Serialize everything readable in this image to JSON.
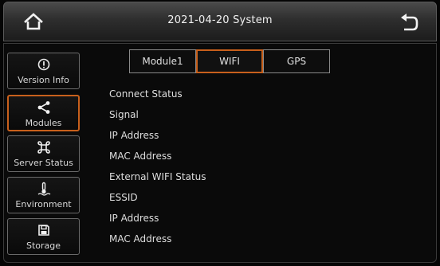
{
  "header": {
    "title": "2021-04-20  System",
    "home_icon": "home-icon",
    "back_icon": "back-arrow-icon"
  },
  "sidebar": {
    "items": [
      {
        "label": "Version Info",
        "icon": "info-circle-icon",
        "active": false
      },
      {
        "label": "Modules",
        "icon": "share-icon",
        "active": true
      },
      {
        "label": "Server Status",
        "icon": "command-icon",
        "active": false
      },
      {
        "label": "Environment",
        "icon": "thermometer-icon",
        "active": false
      },
      {
        "label": "Storage",
        "icon": "floppy-disk-icon",
        "active": false
      }
    ]
  },
  "tabs": [
    {
      "label": "Module1",
      "active": false
    },
    {
      "label": "WIFI",
      "active": true
    },
    {
      "label": "GPS",
      "active": false
    }
  ],
  "wifi": {
    "rows": [
      "Connect Status",
      "Signal",
      "IP Address",
      "MAC Address",
      "External WIFI Status",
      "ESSID",
      "IP Address",
      "MAC Address"
    ]
  },
  "colors": {
    "accent": "#c8601c",
    "text": "#e0e0e0",
    "background": "#050505"
  }
}
